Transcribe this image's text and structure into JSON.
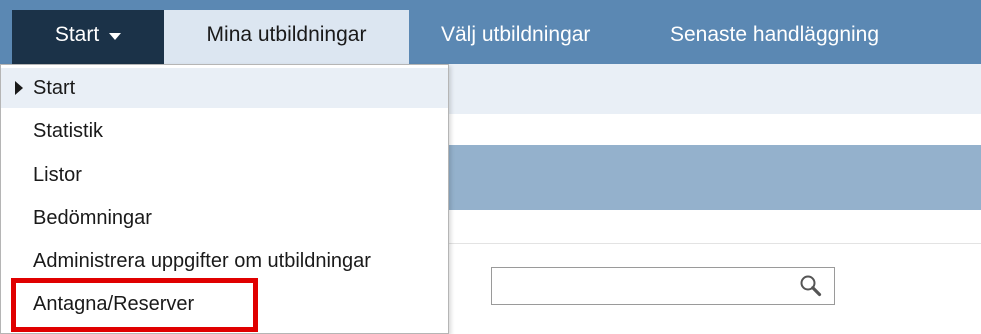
{
  "nav": {
    "start_label": "Start",
    "tabs": [
      {
        "label": "Mina utbildningar"
      },
      {
        "label": "Välj utbildningar"
      },
      {
        "label": "Senaste handläggning"
      }
    ]
  },
  "dropdown": {
    "items": [
      {
        "label": "Start",
        "active": true
      },
      {
        "label": "Statistik"
      },
      {
        "label": "Listor"
      },
      {
        "label": "Bedömningar"
      },
      {
        "label": "Administrera uppgifter om utbildningar"
      },
      {
        "label": "Antagna/Reserver",
        "highlighted": true
      }
    ]
  },
  "search": {
    "value": "",
    "icon": "search-icon"
  },
  "colors": {
    "navbar": "#5b88b3",
    "start_button": "#1b3248",
    "active_tab": "#dce6f1",
    "band": "#94b1cc",
    "highlight": "#e00000"
  }
}
